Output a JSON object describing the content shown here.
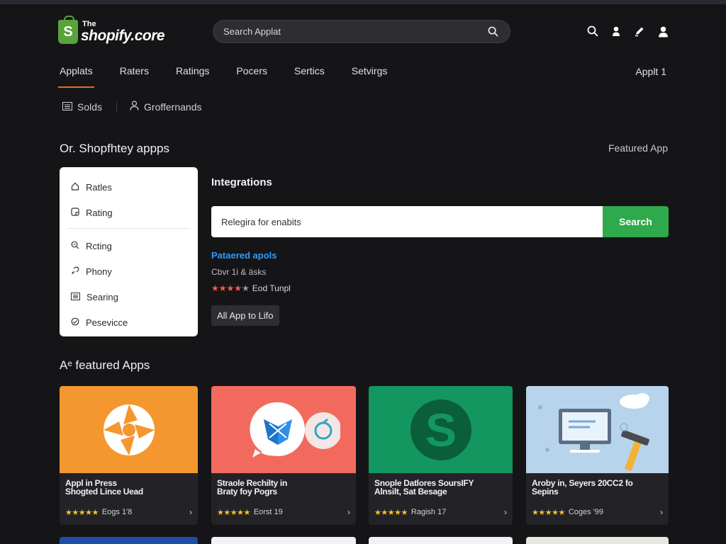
{
  "brand": {
    "the": "The",
    "name": "shopify.core",
    "bag_letter": "S"
  },
  "search": {
    "placeholder": "Search Applat"
  },
  "header_icons": [
    "search-icon",
    "user-icon",
    "pen-icon",
    "account-icon"
  ],
  "nav": {
    "tabs": [
      "Applats",
      "Raters",
      "Ratings",
      "Pocers",
      "Sertics",
      "Setvirgs"
    ],
    "active": 0,
    "right": "Applt 1"
  },
  "subnav": {
    "items": [
      "Solds",
      "Groffernands"
    ]
  },
  "sections": {
    "main_title": "Or. Shopfhtey appps",
    "featured_link": "Featured App",
    "featured_title": "Aᵉ featured Apps"
  },
  "sidebar": {
    "items": [
      {
        "label": "Ratles",
        "icon": "home-icon"
      },
      {
        "label": "Rating",
        "icon": "document-icon"
      },
      {
        "label": "Rcting",
        "icon": "search-zoom-icon"
      },
      {
        "label": "Phony",
        "icon": "link-icon"
      },
      {
        "label": "Searing",
        "icon": "list-icon"
      },
      {
        "label": "Pesevicce",
        "icon": "settings-icon"
      }
    ]
  },
  "integrations": {
    "title": "Integrations",
    "input_placeholder": "Relegira for enabits",
    "button": "Search",
    "partner_title": "Pataered apols",
    "partner_sub": "Cbvr 1i & äsks",
    "partner_rating_text": "Eod Tunpl",
    "partner_stars": 4,
    "all_button": "All App to Lifo"
  },
  "apps": [
    {
      "name": "Appl in Press\nShogted Lince Uead",
      "stars": 5,
      "meta": "Eogs 1'8",
      "color": "#f4972e"
    },
    {
      "name": "Straole Rechilty in\nBraty foy Pogrs",
      "stars": 5,
      "meta": "Eorst 19",
      "color": "#f26a5e"
    },
    {
      "name": "Snople Datlores SoursIFY\nAlnsilt, Sat Besage",
      "stars": 5,
      "meta": "Ragish 17",
      "color": "#13965f"
    },
    {
      "name": "Aroby in, Seyers 20CC2 fo\nSepins",
      "stars": 5,
      "meta": "Coges '99",
      "color": "#b8d4ec"
    }
  ],
  "colors": {
    "accent": "#e9692c",
    "search_button": "#2eaa4c",
    "link": "#2f9bff",
    "background": "#151517"
  }
}
